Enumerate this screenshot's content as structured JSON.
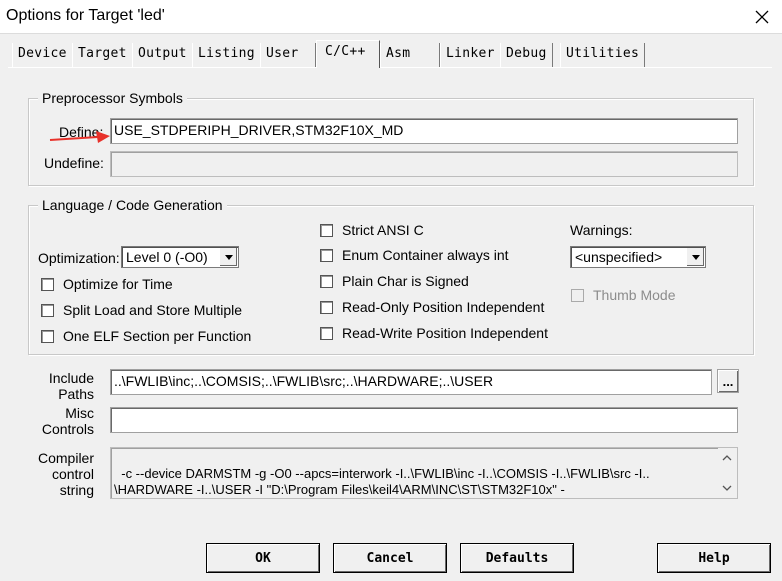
{
  "window": {
    "title": "Options for Target 'led'"
  },
  "tabs": [
    {
      "label": "Device"
    },
    {
      "label": "Target"
    },
    {
      "label": "Output"
    },
    {
      "label": "Listing"
    },
    {
      "label": "User"
    },
    {
      "label": "C/C++"
    },
    {
      "label": "Asm"
    },
    {
      "label": "Linker"
    },
    {
      "label": "Debug"
    },
    {
      "label": "Utilities"
    }
  ],
  "active_tab": "C/C++",
  "preprocessor": {
    "group_title": "Preprocessor Symbols",
    "define_label": "Define:",
    "define_value": "USE_STDPERIPH_DRIVER,STM32F10X_MD",
    "undefine_label": "Undefine:",
    "undefine_value": ""
  },
  "codegen": {
    "group_title": "Language / Code Generation",
    "optimization_label": "Optimization:",
    "optimization_value": "Level 0 (-O0)",
    "optimize_time": "Optimize for Time",
    "split_load": "Split Load and Store Multiple",
    "one_elf": "One ELF Section per Function",
    "strict_ansi": "Strict ANSI C",
    "enum_container": "Enum Container always int",
    "plain_char": "Plain Char is Signed",
    "ro_pi": "Read-Only Position Independent",
    "rw_pi": "Read-Write Position Independent",
    "warnings_label": "Warnings:",
    "warnings_value": "<unspecified>",
    "thumb_mode": "Thumb Mode"
  },
  "paths": {
    "include_label_1": "Include",
    "include_label_2": "Paths",
    "include_value": "..\\FWLIB\\inc;..\\COMSIS;..\\FWLIB\\src;..\\HARDWARE;..\\USER",
    "browse_label": "...",
    "misc_label_1": "Misc",
    "misc_label_2": "Controls",
    "misc_value": "",
    "compiler_label_1": "Compiler",
    "compiler_label_2": "control",
    "compiler_label_3": "string",
    "compiler_value": "-c --device DARMSTM -g -O0 --apcs=interwork -I..\\FWLIB\\inc -I..\\COMSIS -I..\\FWLIB\\src -I..\n\\HARDWARE -I..\\USER -I \"D:\\Program Files\\keil4\\ARM\\INC\\ST\\STM32F10x\" -"
  },
  "buttons": {
    "ok": "OK",
    "cancel": "Cancel",
    "defaults": "Defaults",
    "help": "Help"
  },
  "colors": {
    "dialog_bg": "#f0f0f0",
    "arrow": "#e8322b"
  }
}
